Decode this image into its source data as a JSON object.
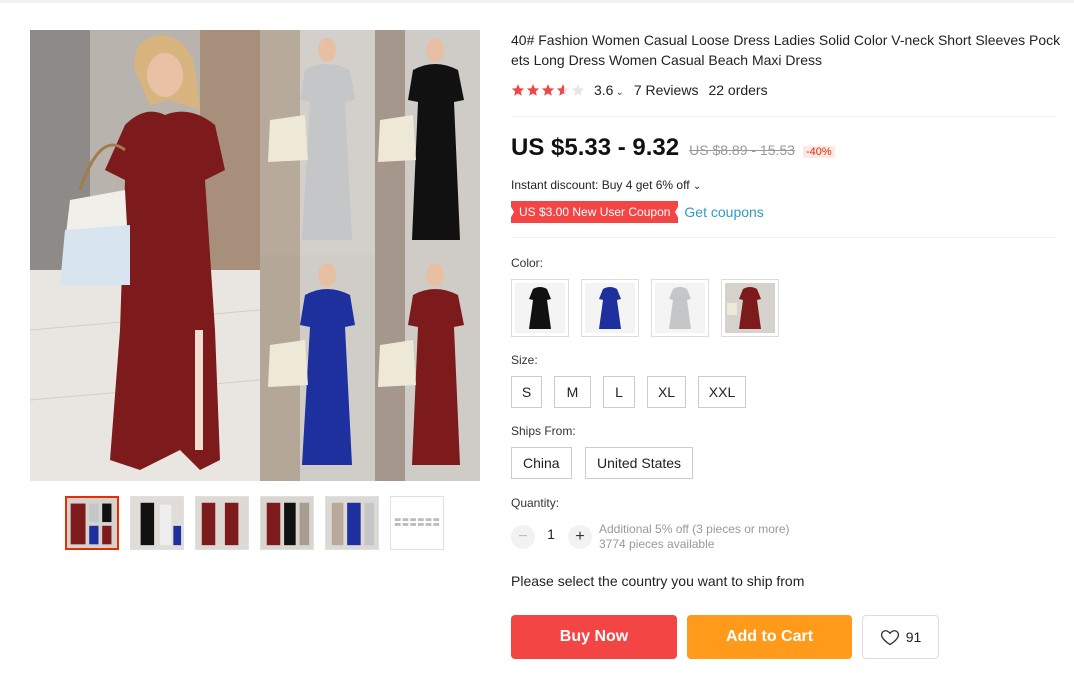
{
  "product": {
    "title": "40# Fashion Women Casual Loose Dress Ladies Solid Color V-neck Short Sleeves Pockets Long Dress Women Casual Beach Maxi Dress",
    "rating": {
      "stars": 3.6,
      "score_text": "3.6",
      "reviews_text": "7 Reviews",
      "orders_text": "22 orders",
      "star_color": "#f44545"
    },
    "price": {
      "current": "US $5.33 - 9.32",
      "original": "US $8.89 - 15.53",
      "discount": "-40%"
    },
    "instant_discount": "Instant discount: Buy 4 get 6% off",
    "coupon": {
      "label": "US $3.00 New User Coupon",
      "link": "Get coupons"
    },
    "color": {
      "label": "Color:",
      "options": [
        "black",
        "blue",
        "gray",
        "burgundy"
      ]
    },
    "size": {
      "label": "Size:",
      "options": [
        "S",
        "M",
        "L",
        "XL",
        "XXL"
      ]
    },
    "ships_from": {
      "label": "Ships From:",
      "options": [
        "China",
        "United States"
      ]
    },
    "quantity": {
      "label": "Quantity:",
      "value": "1",
      "note_line1": "Additional 5% off (3 pieces or more)",
      "note_line2": "3774 pieces available"
    },
    "ship_message": "Please select the country you want to ship from",
    "buttons": {
      "buy_now": "Buy Now",
      "add_to_cart": "Add to Cart",
      "wishlist_count": "91"
    }
  },
  "gallery": {
    "thumbnails": [
      "collage",
      "black",
      "burgundy",
      "black-floor",
      "blue",
      "size-chart"
    ]
  },
  "colors": {
    "accent_red": "#f44545",
    "accent_orange": "#ff9a1a",
    "link_blue": "#2e9cc3",
    "burgundy": "#7d1a1c",
    "blue": "#1e2f9e",
    "gray": "#c5c6c8",
    "black": "#111111"
  }
}
